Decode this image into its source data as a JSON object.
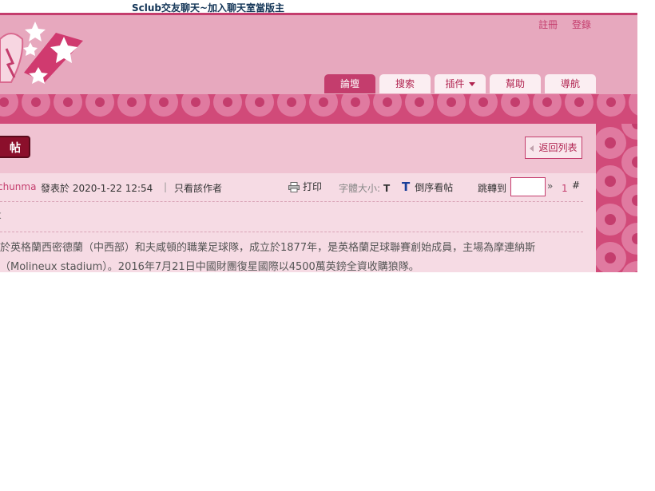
{
  "topbar": {
    "title": "Sclub交友聊天~加入聊天室當版主"
  },
  "header": {
    "links": {
      "register": "註冊",
      "login": "登錄"
    }
  },
  "nav": {
    "tabs": [
      {
        "label": "論壇",
        "active": true
      },
      {
        "label": "搜索",
        "active": false
      },
      {
        "label": "插件",
        "active": false,
        "dropdown": true
      },
      {
        "label": "幫助",
        "active": false
      },
      {
        "label": "導航",
        "active": false
      }
    ]
  },
  "thread": {
    "reply_label": "帖",
    "back_label": "返回列表",
    "author": "chunma",
    "posted_on": "發表於 2020-1-22 12:54",
    "separator": "|",
    "only_author": "只看該作者",
    "print": "打印",
    "font_size_label": "字體大小:",
    "font_size_value": "T",
    "reverse_icon": "T",
    "reverse": "倒序看帖",
    "jump_to": "跳轉到",
    "jump_value": "",
    "raquo": "»",
    "floor": "1",
    "hash": "#",
    "subtitle_fragment": "k",
    "body_line1": "於英格蘭西密德蘭（中西部）和夫咸頓的職業足球隊，成立於1877年，是英格蘭足球聯賽創始成員，主場為摩連納斯",
    "body_line2": "（Molineux stadium）。2016年7月21日中國財團復星國際以4500萬英鎊全資收購狼隊。"
  },
  "colors": {
    "accent": "#c43d6d",
    "header_bg": "#e7a8be",
    "content_bg": "#f6dbe4"
  }
}
